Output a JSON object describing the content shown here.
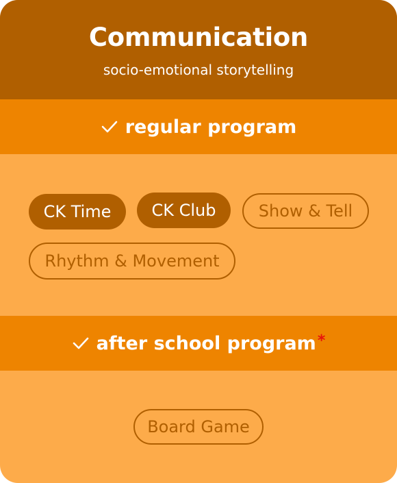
{
  "header": {
    "title": "Communication",
    "subtitle": "socio-emotional storytelling"
  },
  "regular": {
    "label": "regular program",
    "check_icon": "checkmark-icon",
    "chips": [
      {
        "label": "CK Time",
        "state": "selected"
      },
      {
        "label": "CK Club",
        "state": "selected"
      },
      {
        "label": "Show & Tell",
        "state": "unselected"
      },
      {
        "label": "Rhythm & Movement",
        "state": "unselected"
      }
    ]
  },
  "after_school": {
    "label": "after school program",
    "required_mark": "*",
    "check_icon": "checkmark-icon",
    "chips": [
      {
        "label": "Board Game",
        "state": "unselected"
      }
    ]
  },
  "colors": {
    "header_bg": "#b05f00",
    "band_bg": "#ee8400",
    "body_bg": "#fdab4a",
    "chip_selected_bg": "#b05f00",
    "required_mark": "#e8140c"
  }
}
